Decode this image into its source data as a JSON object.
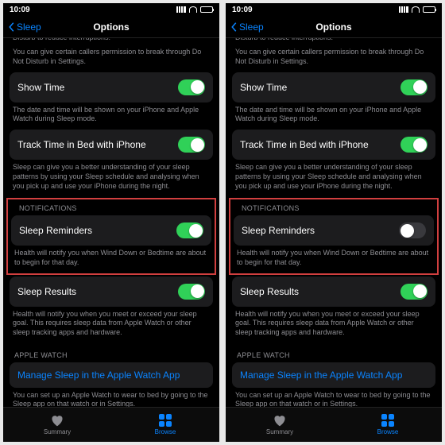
{
  "status": {
    "time": "10:09"
  },
  "nav": {
    "back": "Sleep",
    "title": "Options"
  },
  "intro_cut": "screen at your scheduled Bedtime. It will also turn on Do Not Disturb to reduce interruptions.",
  "intro2": "You can give certain callers permission to break through Do Not Disturb in Settings.",
  "show_time": {
    "label": "Show Time",
    "desc": "The date and time will be shown on your iPhone and Apple Watch during Sleep mode."
  },
  "track": {
    "label": "Track Time in Bed with iPhone",
    "desc": "Sleep can give you a better understanding of your sleep patterns by using your Sleep schedule and analysing when you pick up and use your iPhone during the night."
  },
  "section_notifications": "NOTIFICATIONS",
  "reminders": {
    "label": "Sleep Reminders",
    "desc": "Health will notify you when Wind Down or Bedtime are about to begin for that day."
  },
  "results": {
    "label": "Sleep Results",
    "desc": "Health will notify you when you meet or exceed your sleep goal. This requires sleep data from Apple Watch or other sleep tracking apps and hardware."
  },
  "section_watch": "APPLE WATCH",
  "watch": {
    "link": "Manage Sleep in the Apple Watch App",
    "desc": "You can set up an Apple Watch to wear to bed by going to the Sleep app on that watch or in Settings."
  },
  "tabs": {
    "summary": "Summary",
    "browse": "Browse"
  },
  "panes": [
    {
      "reminders_on": true
    },
    {
      "reminders_on": false
    }
  ]
}
